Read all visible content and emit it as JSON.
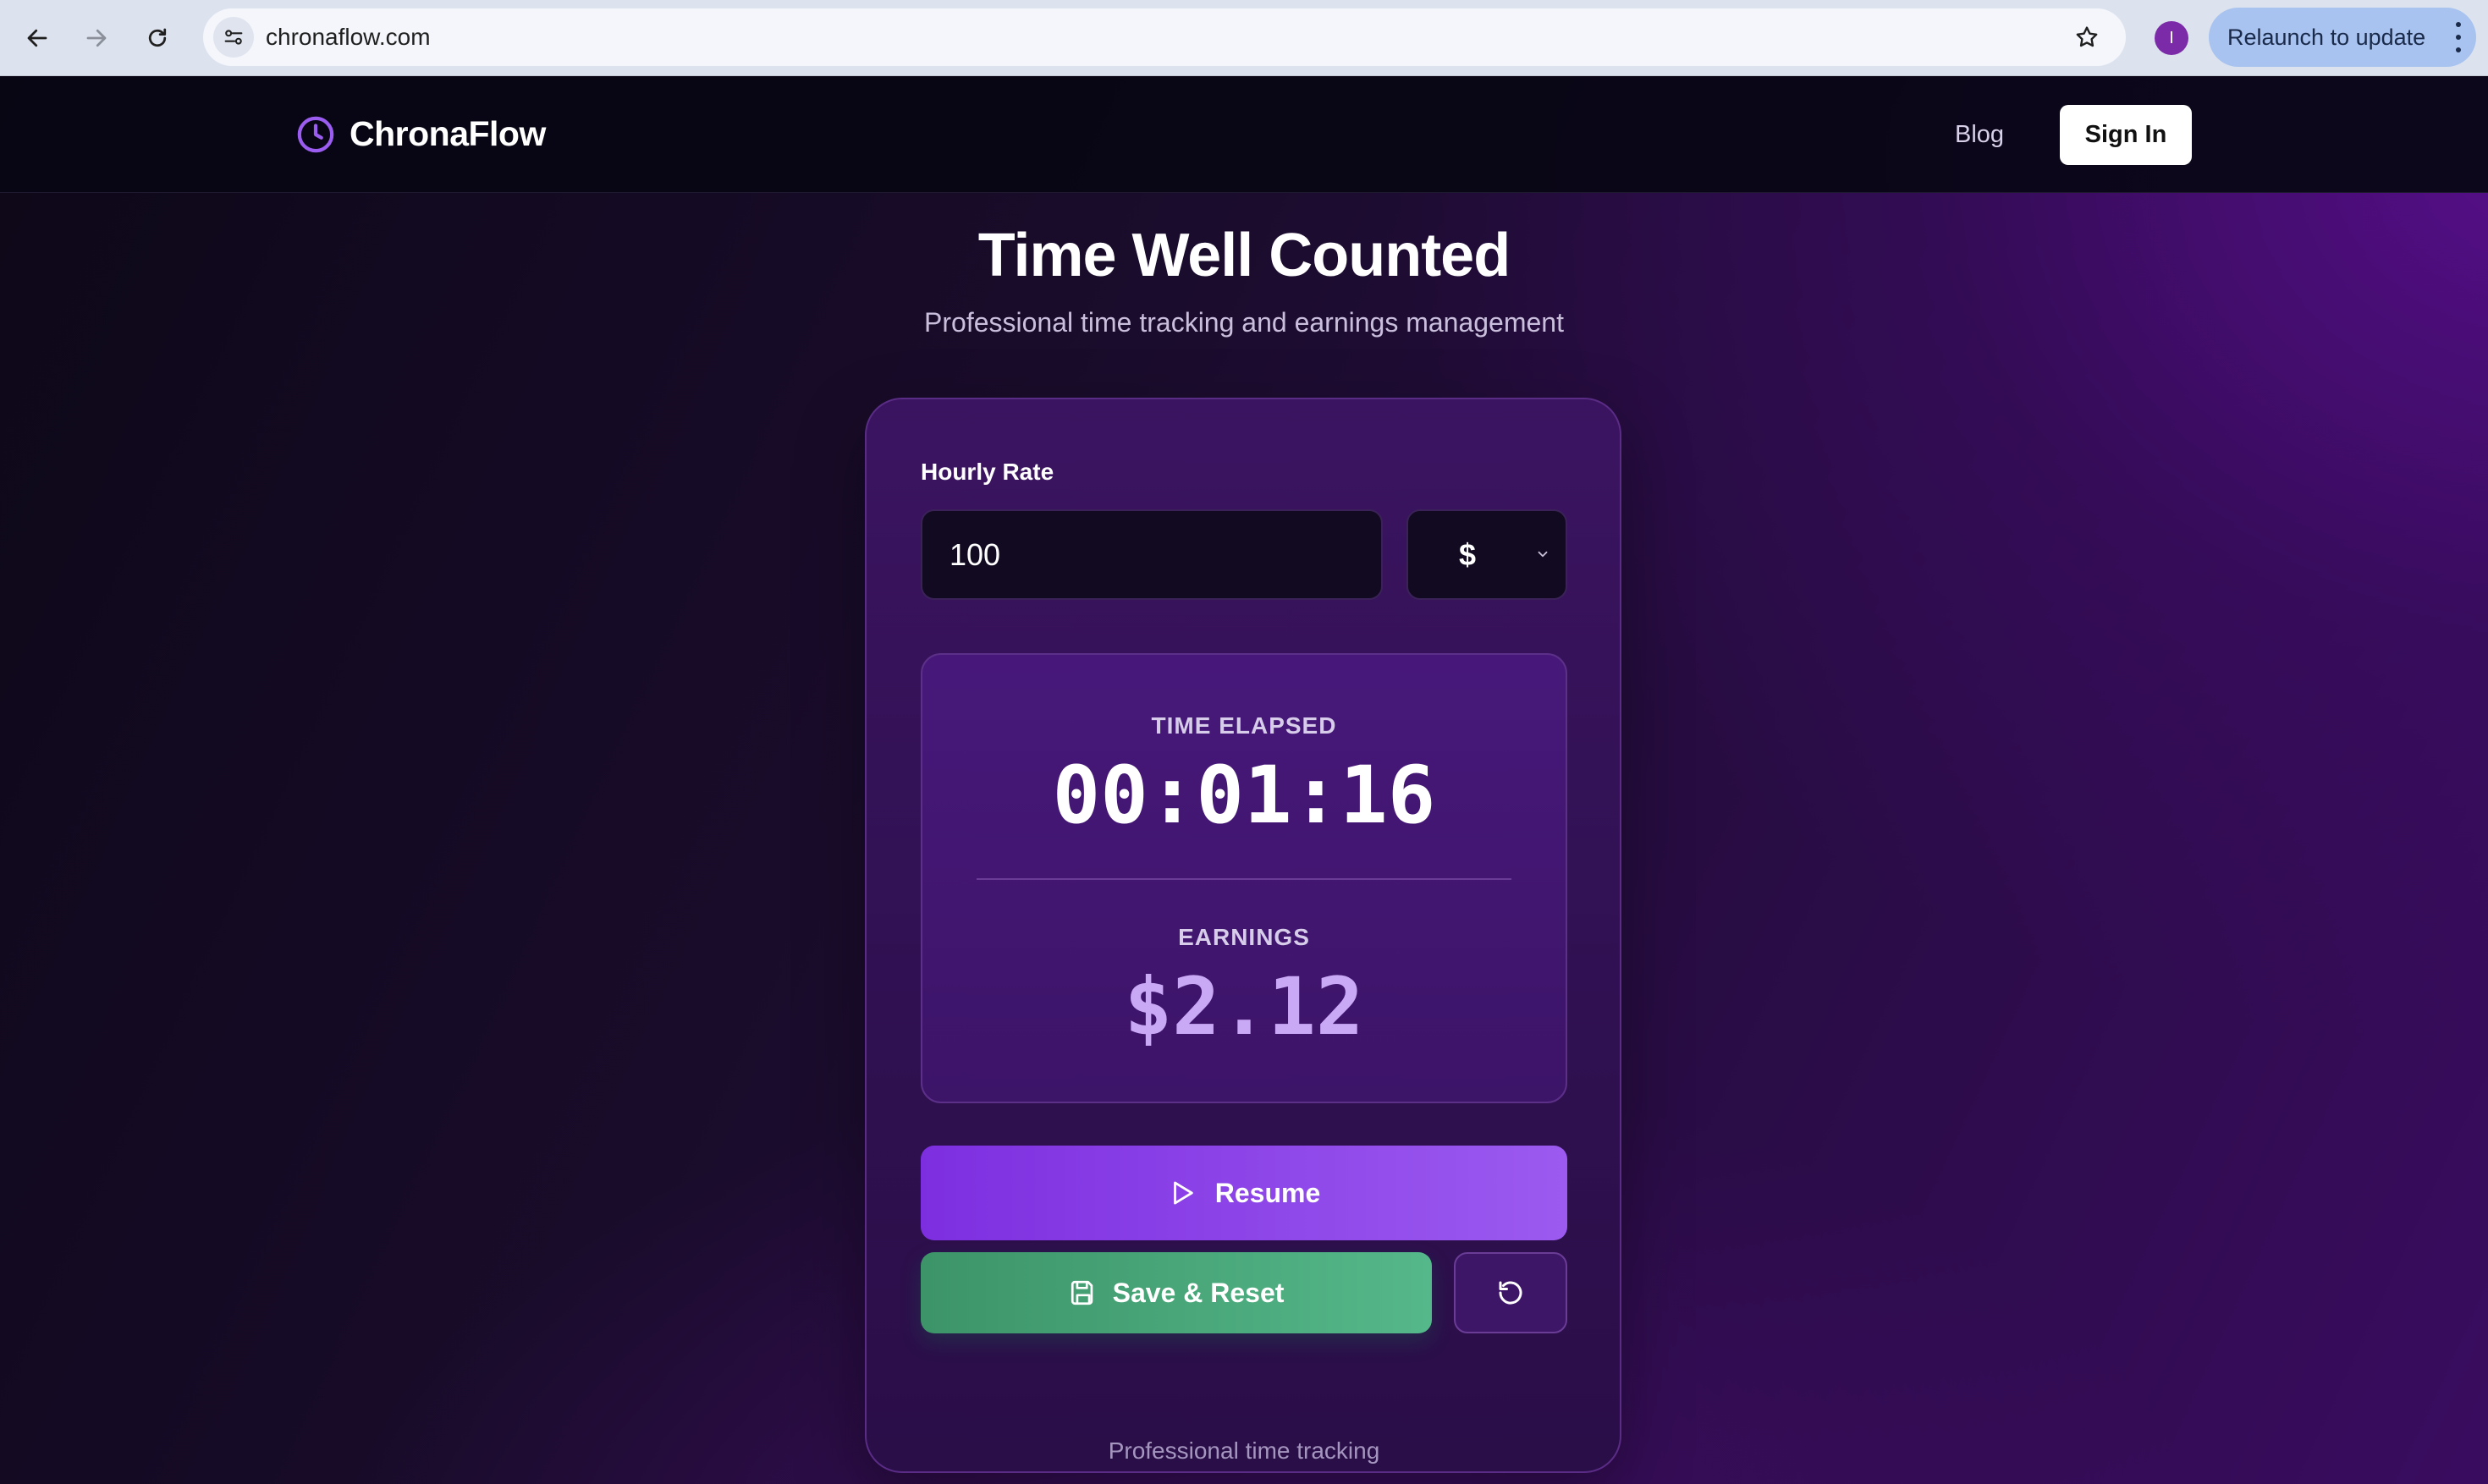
{
  "browser": {
    "url": "chronaflow.com",
    "profile_initial": "I",
    "relaunch_label": "Relaunch to update",
    "icons": [
      "back-arrow-icon",
      "forward-arrow-icon",
      "reload-icon",
      "site-info-icon",
      "star-icon",
      "more-vert-icon"
    ]
  },
  "header": {
    "brand": "ChronaFlow",
    "nav_blog": "Blog",
    "sign_in": "Sign In"
  },
  "hero": {
    "title": "Time Well Counted",
    "subtitle": "Professional time tracking and earnings management"
  },
  "tracker": {
    "rate_label": "Hourly Rate",
    "rate_value": "100",
    "currency": "$",
    "time_label": "TIME ELAPSED",
    "time_value": "00:01:16",
    "earnings_label": "EARNINGS",
    "earnings_value": "$2.12",
    "resume_label": "Resume",
    "save_label": "Save & Reset"
  },
  "footer": {
    "text": "Professional time tracking"
  },
  "colors": {
    "accent_purple": "#8b3fe8",
    "save_green": "#4aa878",
    "earnings_text": "#c9a8f5",
    "logo_purple": "#9b5cf0"
  }
}
